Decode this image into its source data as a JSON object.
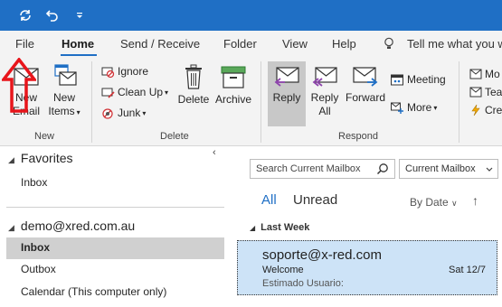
{
  "tabs": [
    "File",
    "Home",
    "Send / Receive",
    "Folder",
    "View",
    "Help"
  ],
  "tell_me": "Tell me what you w",
  "ribbon": {
    "new_email": [
      "New",
      "Email"
    ],
    "new_items": [
      "New",
      "Items"
    ],
    "ignore": "Ignore",
    "clean_up": "Clean Up",
    "junk": "Junk",
    "delete": "Delete",
    "archive": "Archive",
    "reply": "Reply",
    "reply_all": [
      "Reply",
      "All"
    ],
    "forward": "Forward",
    "meeting": "Meeting",
    "more": "More",
    "partial_items": [
      "Mo",
      "Tea",
      "Cre"
    ],
    "group_new": "New",
    "group_delete": "Delete",
    "group_respond": "Respond"
  },
  "folders": {
    "favorites_header": "Favorites",
    "favorites_inbox": "Inbox",
    "account": "demo@xred.com.au",
    "items": [
      "Inbox",
      "Outbox",
      "Calendar (This computer only)"
    ]
  },
  "mail": {
    "search_placeholder": "Search Current Mailbox",
    "scope": "Current Mailbox",
    "filter_all": "All",
    "filter_unread": "Unread",
    "sort": "By Date",
    "group": "Last Week",
    "message": {
      "sender": "soporte@x-red.com",
      "subject": "Welcome",
      "date": "Sat 12/7",
      "preview": "Estimado Usuario:"
    }
  },
  "colors": {
    "accent": "#1f6fc5",
    "annotation": "#e8151b",
    "selected_mail": "#cde3f7"
  }
}
